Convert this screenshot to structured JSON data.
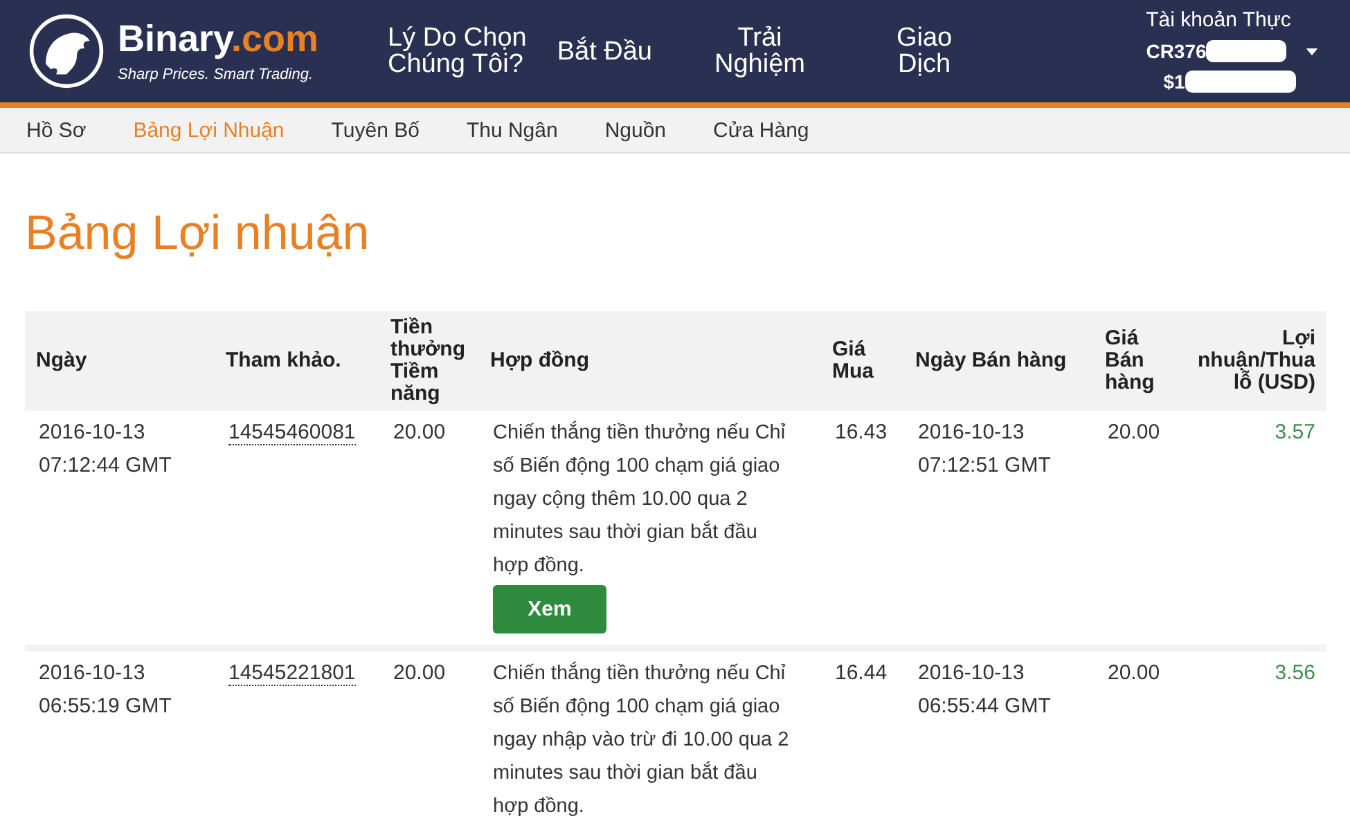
{
  "header": {
    "brand_name": "Binary",
    "brand_suffix": ".com",
    "tagline": "Sharp Prices. Smart Trading.",
    "nav": [
      "Lý Do Chọn\nChúng Tôi?",
      "Bắt Đầu",
      "Trải\nNghiệm",
      "Giao\nDịch"
    ],
    "account": {
      "type": "Tài khoản Thực",
      "id": "CR376",
      "balance": "$1"
    }
  },
  "subnav": [
    {
      "label": "Hồ Sơ",
      "selected": false
    },
    {
      "label": "Bảng Lợi Nhuận",
      "selected": true
    },
    {
      "label": "Tuyên Bố",
      "selected": false
    },
    {
      "label": "Thu Ngân",
      "selected": false
    },
    {
      "label": "Nguồn",
      "selected": false
    },
    {
      "label": "Cửa Hàng",
      "selected": false
    }
  ],
  "page_title": "Bảng Lợi nhuận",
  "table": {
    "columns": [
      "Ngày",
      "Tham khảo.",
      "Tiền thưởng Tiềm năng",
      "Hợp đồng",
      "Giá Mua",
      "Ngày Bán hàng",
      "Giá Bán hàng",
      "Lợi nhuận/Thua lỗ (USD)"
    ],
    "rows": [
      {
        "date": "2016-10-13\n07:12:44 GMT",
        "ref": "14545460081",
        "payout": "20.00",
        "contract": "Chiến thắng tiền thưởng nếu Chỉ số Biến động 100 chạm giá giao ngay cộng thêm 10.00 qua 2 minutes sau thời gian bắt đầu hợp đồng.",
        "button": "Xem",
        "buy": "16.43",
        "sell_date": "2016-10-13\n07:12:51 GMT",
        "sell": "20.00",
        "profit": "3.57"
      },
      {
        "date": "2016-10-13\n06:55:19 GMT",
        "ref": "14545221801",
        "payout": "20.00",
        "contract": "Chiến thắng tiền thưởng nếu Chỉ số Biến động 100 chạm giá giao ngay nhập vào trừ đi 10.00 qua 2 minutes sau thời gian bắt đầu hợp đồng.",
        "buy": "16.44",
        "sell_date": "2016-10-13\n06:55:44 GMT",
        "sell": "20.00",
        "profit": "3.56"
      }
    ]
  }
}
